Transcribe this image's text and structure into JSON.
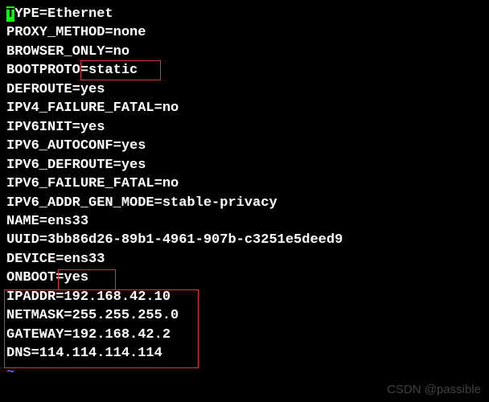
{
  "lines": {
    "l0_rest": "YPE=Ethernet",
    "l1": "PROXY_METHOD=none",
    "l2": "BROWSER_ONLY=no",
    "l3": "BOOTPROTO=static",
    "l4": "DEFROUTE=yes",
    "l5": "IPV4_FAILURE_FATAL=no",
    "l6": "IPV6INIT=yes",
    "l7": "IPV6_AUTOCONF=yes",
    "l8": "IPV6_DEFROUTE=yes",
    "l9": "IPV6_FAILURE_FATAL=no",
    "l10": "IPV6_ADDR_GEN_MODE=stable-privacy",
    "l11": "NAME=ens33",
    "l12": "UUID=3bb86d26-89b1-4961-907b-c3251e5deed9",
    "l13": "DEVICE=ens33",
    "l14": "ONBOOT=yes",
    "l15": "IPADDR=192.168.42.10",
    "l16": "NETMASK=255.255.255.0",
    "l17": "GATEWAY=192.168.42.2",
    "l18": "DNS=114.114.114.114",
    "tilde": "~"
  },
  "cursor_char": "T",
  "watermark": "CSDN @passible"
}
